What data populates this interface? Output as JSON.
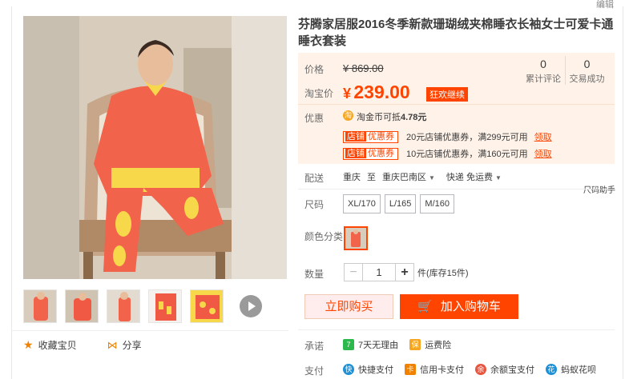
{
  "header": {
    "edit_label": "编辑"
  },
  "product": {
    "title": "芬腾家居服2016冬季新款珊瑚绒夹棉睡衣长袖女士可爱卡通睡衣套装"
  },
  "price": {
    "orig_label": "价格",
    "orig_value": "¥ 869.00",
    "promo_label": "淘宝价",
    "promo_yen": "¥",
    "promo_value": "239.00",
    "promo_tag": "狂欢继续",
    "stats": [
      {
        "num": "0",
        "label": "累计评论"
      },
      {
        "num": "0",
        "label": "交易成功"
      }
    ]
  },
  "offers": {
    "label": "优惠",
    "coin_icon": "淘",
    "coin_text_prefix": "淘金币可抵",
    "coin_value": "4.78元",
    "coupons": [
      {
        "tag_a": "店铺",
        "tag_b": "优惠券",
        "text": "20元店铺优惠券，满299元可用",
        "get": "领取"
      },
      {
        "tag_a": "店铺",
        "tag_b": "优惠券",
        "text": "10元店铺优惠券，满160元可用",
        "get": "领取"
      }
    ]
  },
  "shipping": {
    "label": "配送",
    "from": "重庆",
    "to_word": "至",
    "dest": "重庆巴南区",
    "method": "快递 免运费"
  },
  "size": {
    "label": "尺码",
    "help": "尺码助手",
    "options": [
      "XL/170",
      "L/165",
      "M/160"
    ]
  },
  "color": {
    "label": "颜色分类"
  },
  "quantity": {
    "label": "数量",
    "minus": "−",
    "value": "1",
    "plus": "+",
    "stock": "件(库存15件)"
  },
  "actions": {
    "buy_now": "立即购买",
    "add_cart": "加入购物车",
    "favorite": "收藏宝贝",
    "share": "分享"
  },
  "promise": {
    "label": "承诺",
    "items": [
      {
        "icon": "7",
        "text": "7天无理由",
        "color": "#2db84d"
      },
      {
        "icon": "保",
        "text": "运费险",
        "color": "#f5a623"
      }
    ]
  },
  "payment": {
    "label": "支付",
    "items": [
      {
        "icon": "快",
        "text": "快捷支付",
        "color": "#1e90d6"
      },
      {
        "icon": "卡",
        "text": "信用卡支付",
        "color": "#f08200"
      },
      {
        "icon": "余",
        "text": "余额宝支付",
        "color": "#e8553f"
      },
      {
        "icon": "花",
        "text": "蚂蚁花呗",
        "color": "#1e90d6"
      }
    ]
  },
  "colors": {
    "accent": "#ff4400",
    "price_bg": "#fff2e8"
  }
}
